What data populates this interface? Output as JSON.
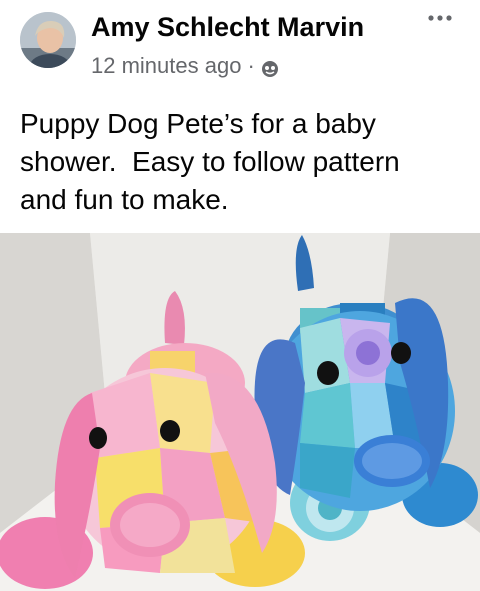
{
  "post": {
    "author_name": "Amy Schlecht Marvin",
    "timestamp": "12 minutes ago",
    "separator": "·",
    "audience_icon": "globe-icon",
    "menu_icon": "more-options-icon",
    "text": "Puppy Dog Pete’s for a baby\nshower.  Easy to follow pattern\nand fun to make.",
    "photo_subject": "two stuffed patchwork puppy toys, one pink and one blue"
  },
  "colors": {
    "author": "#050505",
    "meta": "#65676b",
    "text": "#050505",
    "background": "#ffffff"
  }
}
